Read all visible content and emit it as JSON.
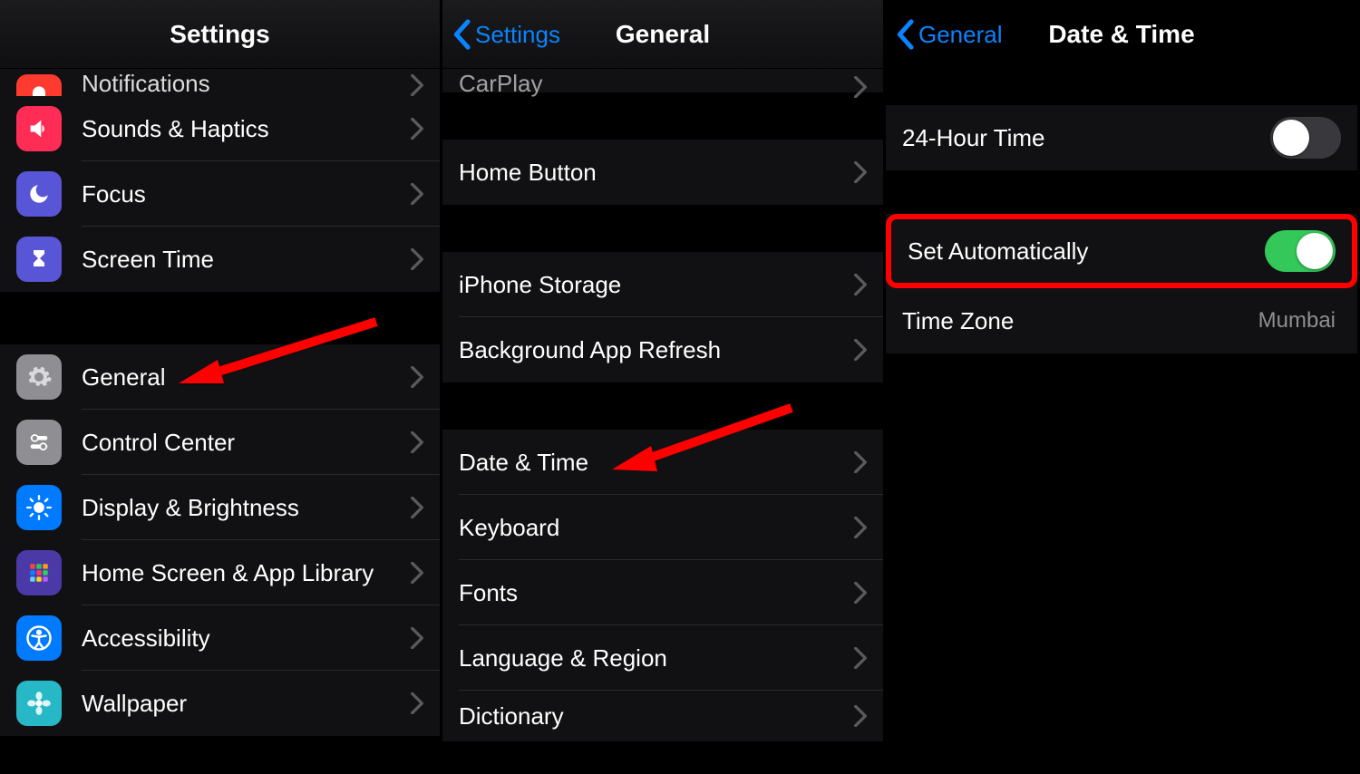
{
  "panel1": {
    "title": "Settings",
    "rows_g1": [
      {
        "label": "Notifications"
      },
      {
        "label": "Sounds & Haptics"
      },
      {
        "label": "Focus"
      },
      {
        "label": "Screen Time"
      }
    ],
    "rows_g2": [
      {
        "label": "General"
      },
      {
        "label": "Control Center"
      },
      {
        "label": "Display & Brightness"
      },
      {
        "label": "Home Screen & App Library"
      },
      {
        "label": "Accessibility"
      },
      {
        "label": "Wallpaper"
      }
    ]
  },
  "panel2": {
    "back": "Settings",
    "title": "General",
    "partial_label": "CarPlay",
    "rows_g1": [
      {
        "label": "Home Button"
      }
    ],
    "rows_g2": [
      {
        "label": "iPhone Storage"
      },
      {
        "label": "Background App Refresh"
      }
    ],
    "rows_g3": [
      {
        "label": "Date & Time"
      },
      {
        "label": "Keyboard"
      },
      {
        "label": "Fonts"
      },
      {
        "label": "Language & Region"
      },
      {
        "label": "Dictionary"
      }
    ]
  },
  "panel3": {
    "back": "General",
    "title": "Date & Time",
    "rows_g1": [
      {
        "label": "24-Hour Time",
        "toggle": "off"
      }
    ],
    "rows_g2": [
      {
        "label": "Set Automatically",
        "toggle": "on"
      },
      {
        "label": "Time Zone",
        "value": "Mumbai"
      }
    ]
  }
}
